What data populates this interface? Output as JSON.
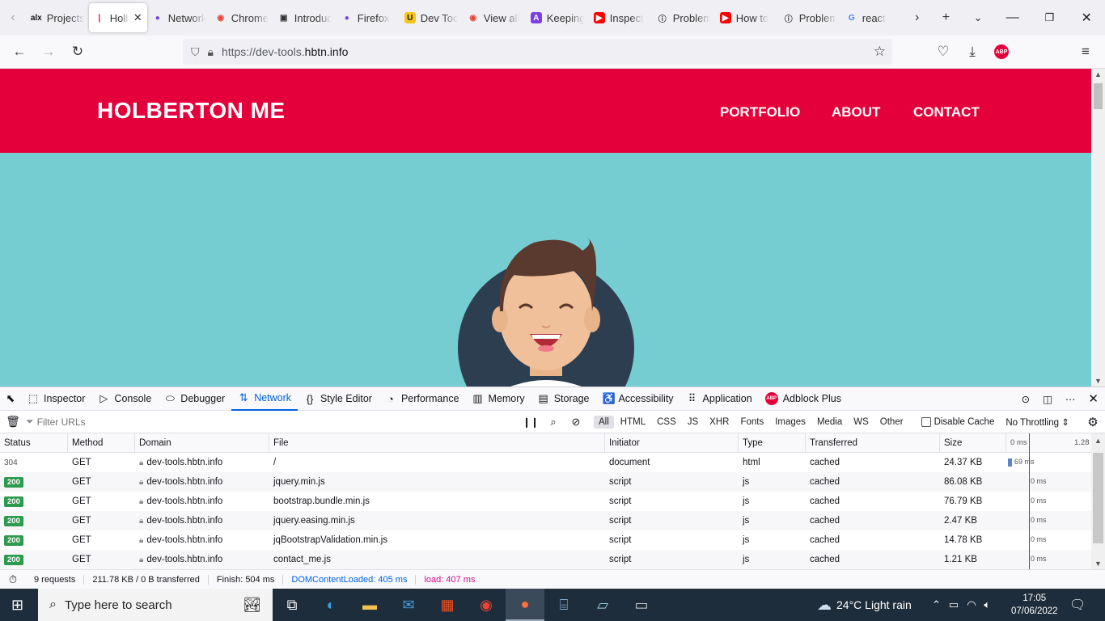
{
  "browser": {
    "tabs": [
      {
        "title": "Projects",
        "favicon": "alx-icon",
        "fav_text": "alx",
        "fav_bg": "transparent",
        "fav_color": "#111"
      },
      {
        "title": "Holberton",
        "favicon": "holberton-icon",
        "fav_text": "❘",
        "fav_bg": "transparent",
        "fav_color": "#e4013b",
        "active": true
      },
      {
        "title": "Network",
        "favicon": "firefox-icon",
        "fav_text": "●",
        "fav_bg": "transparent",
        "fav_color": "#7542e5"
      },
      {
        "title": "Chrome",
        "favicon": "chrome-icon",
        "fav_text": "◉",
        "fav_bg": "transparent",
        "fav_color": "#ea4335"
      },
      {
        "title": "Introduction",
        "favicon": "book-icon",
        "fav_text": "▣",
        "fav_bg": "transparent",
        "fav_color": "#333"
      },
      {
        "title": "Firefox",
        "favicon": "firefox-icon",
        "fav_text": "●",
        "fav_bg": "transparent",
        "fav_color": "#7542e5"
      },
      {
        "title": "Dev Tools",
        "favicon": "udemy-icon",
        "fav_text": "U",
        "fav_bg": "#f5c518",
        "fav_color": "#111"
      },
      {
        "title": "View all",
        "favicon": "chrome-icon",
        "fav_text": "◉",
        "fav_bg": "transparent",
        "fav_color": "#ea4335"
      },
      {
        "title": "Keeping",
        "favicon": "app-icon",
        "fav_text": "A",
        "fav_bg": "#7b3fe4",
        "fav_color": "#fff"
      },
      {
        "title": "Inspect",
        "favicon": "youtube-icon",
        "fav_text": "▶",
        "fav_bg": "#ff0000",
        "fav_color": "#fff"
      },
      {
        "title": "Problem",
        "favicon": "info-icon",
        "fav_text": "ⓘ",
        "fav_bg": "transparent",
        "fav_color": "#333"
      },
      {
        "title": "How to",
        "favicon": "youtube-icon",
        "fav_text": "▶",
        "fav_bg": "#ff0000",
        "fav_color": "#fff"
      },
      {
        "title": "Problem",
        "favicon": "info-icon",
        "fav_text": "ⓘ",
        "fav_bg": "transparent",
        "fav_color": "#333"
      },
      {
        "title": "react",
        "favicon": "google-icon",
        "fav_text": "G",
        "fav_bg": "transparent",
        "fav_color": "#4285f4"
      }
    ],
    "url_proto": "https://dev-tools.",
    "url_host": "hbtn.info"
  },
  "site": {
    "brand": "HOLBERTON ME",
    "nav": [
      "PORTFOLIO",
      "ABOUT",
      "CONTACT"
    ],
    "header_color": "#e4013b",
    "hero_color": "#76cdd1"
  },
  "devtools": {
    "tabs": [
      {
        "label": "Inspector",
        "icon": "inspector-icon",
        "glyph": "⬚"
      },
      {
        "label": "Console",
        "icon": "console-icon",
        "glyph": "▷"
      },
      {
        "label": "Debugger",
        "icon": "debugger-icon",
        "glyph": "⬭"
      },
      {
        "label": "Network",
        "icon": "network-icon",
        "glyph": "⇅",
        "active": true
      },
      {
        "label": "Style Editor",
        "icon": "style-editor-icon",
        "glyph": "{}"
      },
      {
        "label": "Performance",
        "icon": "performance-icon",
        "glyph": "◔"
      },
      {
        "label": "Memory",
        "icon": "memory-icon",
        "glyph": "▥"
      },
      {
        "label": "Storage",
        "icon": "storage-icon",
        "glyph": "▤"
      },
      {
        "label": "Accessibility",
        "icon": "accessibility-icon",
        "glyph": "♿"
      },
      {
        "label": "Application",
        "icon": "application-icon",
        "glyph": "⠿"
      },
      {
        "label": "Adblock Plus",
        "icon": "abp-icon",
        "glyph": "ABP"
      }
    ],
    "filter_placeholder": "Filter URLs",
    "filter_types": [
      "All",
      "HTML",
      "CSS",
      "JS",
      "XHR",
      "Fonts",
      "Images",
      "Media",
      "WS",
      "Other"
    ],
    "disable_cache": "Disable Cache",
    "throttling": "No Throttling",
    "columns": [
      "Status",
      "Method",
      "Domain",
      "File",
      "Initiator",
      "Type",
      "Transferred",
      "Size"
    ],
    "waterfall_ticks": [
      "0 ms",
      "1.28"
    ],
    "rows": [
      {
        "status": "304",
        "method": "GET",
        "domain": "dev-tools.hbtn.info",
        "file": "/",
        "initiator": "document",
        "type": "html",
        "transferred": "cached",
        "size": "24.37 KB",
        "timing": "69 ms"
      },
      {
        "status": "200",
        "method": "GET",
        "domain": "dev-tools.hbtn.info",
        "file": "jquery.min.js",
        "initiator": "script",
        "type": "js",
        "transferred": "cached",
        "size": "86.08 KB",
        "timing": "0 ms"
      },
      {
        "status": "200",
        "method": "GET",
        "domain": "dev-tools.hbtn.info",
        "file": "bootstrap.bundle.min.js",
        "initiator": "script",
        "type": "js",
        "transferred": "cached",
        "size": "76.79 KB",
        "timing": "0 ms"
      },
      {
        "status": "200",
        "method": "GET",
        "domain": "dev-tools.hbtn.info",
        "file": "jquery.easing.min.js",
        "initiator": "script",
        "type": "js",
        "transferred": "cached",
        "size": "2.47 KB",
        "timing": "0 ms"
      },
      {
        "status": "200",
        "method": "GET",
        "domain": "dev-tools.hbtn.info",
        "file": "jqBootstrapValidation.min.js",
        "initiator": "script",
        "type": "js",
        "transferred": "cached",
        "size": "14.78 KB",
        "timing": "0 ms"
      },
      {
        "status": "200",
        "method": "GET",
        "domain": "dev-tools.hbtn.info",
        "file": "contact_me.js",
        "initiator": "script",
        "type": "js",
        "transferred": "cached",
        "size": "1.21 KB",
        "timing": "0 ms"
      }
    ],
    "status": {
      "requests": "9 requests",
      "transferred": "211.78 KB / 0 B transferred",
      "finish": "Finish: 504 ms",
      "dom": "DOMContentLoaded: 405 ms",
      "load": "load: 407 ms"
    }
  },
  "taskbar": {
    "search_placeholder": "Type here to search",
    "weather": "24°C  Light rain",
    "time": "17:05",
    "date": "07/06/2022"
  }
}
